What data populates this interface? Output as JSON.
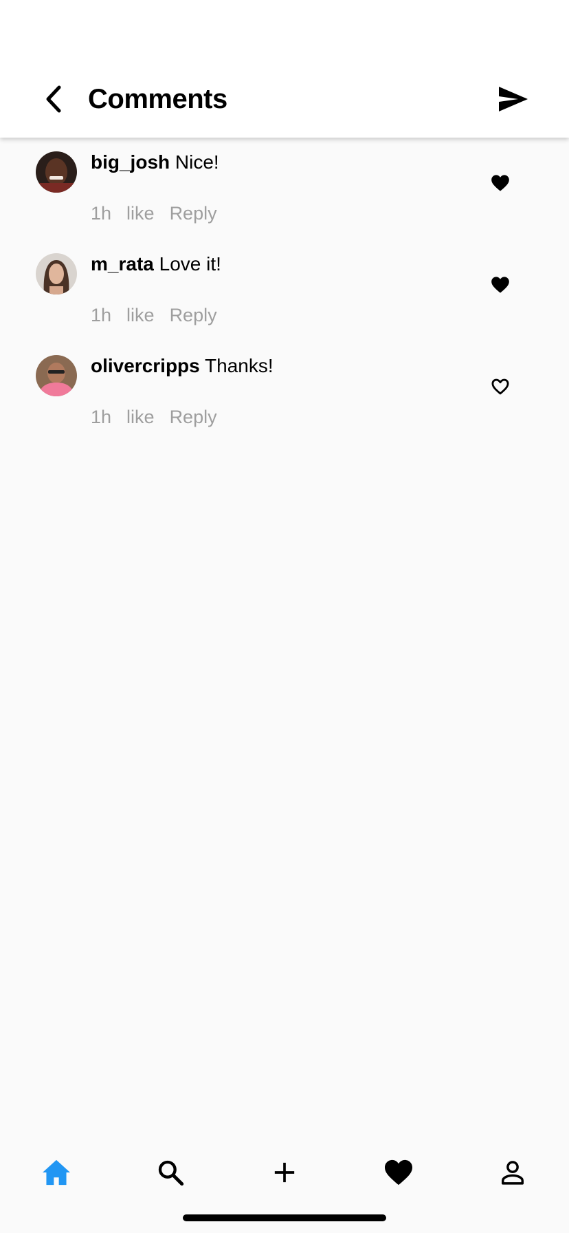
{
  "header": {
    "title": "Comments",
    "back_icon": "chevron-left-icon",
    "send_icon": "send-icon"
  },
  "comments": [
    {
      "username": "big_josh",
      "text": "Nice!",
      "time": "1h",
      "like_label": "like",
      "reply_label": "Reply",
      "liked": true,
      "avatar": "avatar-big-josh"
    },
    {
      "username": "m_rata",
      "text": "Love it!",
      "time": "1h",
      "like_label": "like",
      "reply_label": "Reply",
      "liked": true,
      "avatar": "avatar-m-rata"
    },
    {
      "username": "olivercripps",
      "text": "Thanks!",
      "time": "1h",
      "like_label": "like",
      "reply_label": "Reply",
      "liked": false,
      "avatar": "avatar-olivercripps"
    }
  ],
  "bottom_nav": {
    "items": [
      {
        "icon": "home-icon",
        "active": true
      },
      {
        "icon": "search-icon",
        "active": false
      },
      {
        "icon": "plus-icon",
        "active": false
      },
      {
        "icon": "heart-icon",
        "active": false
      },
      {
        "icon": "profile-icon",
        "active": false
      }
    ],
    "active_color": "#2196f3",
    "inactive_color": "#000000"
  },
  "colors": {
    "background": "#fafafa",
    "header_bg": "#ffffff",
    "meta_text": "#9e9e9e"
  }
}
